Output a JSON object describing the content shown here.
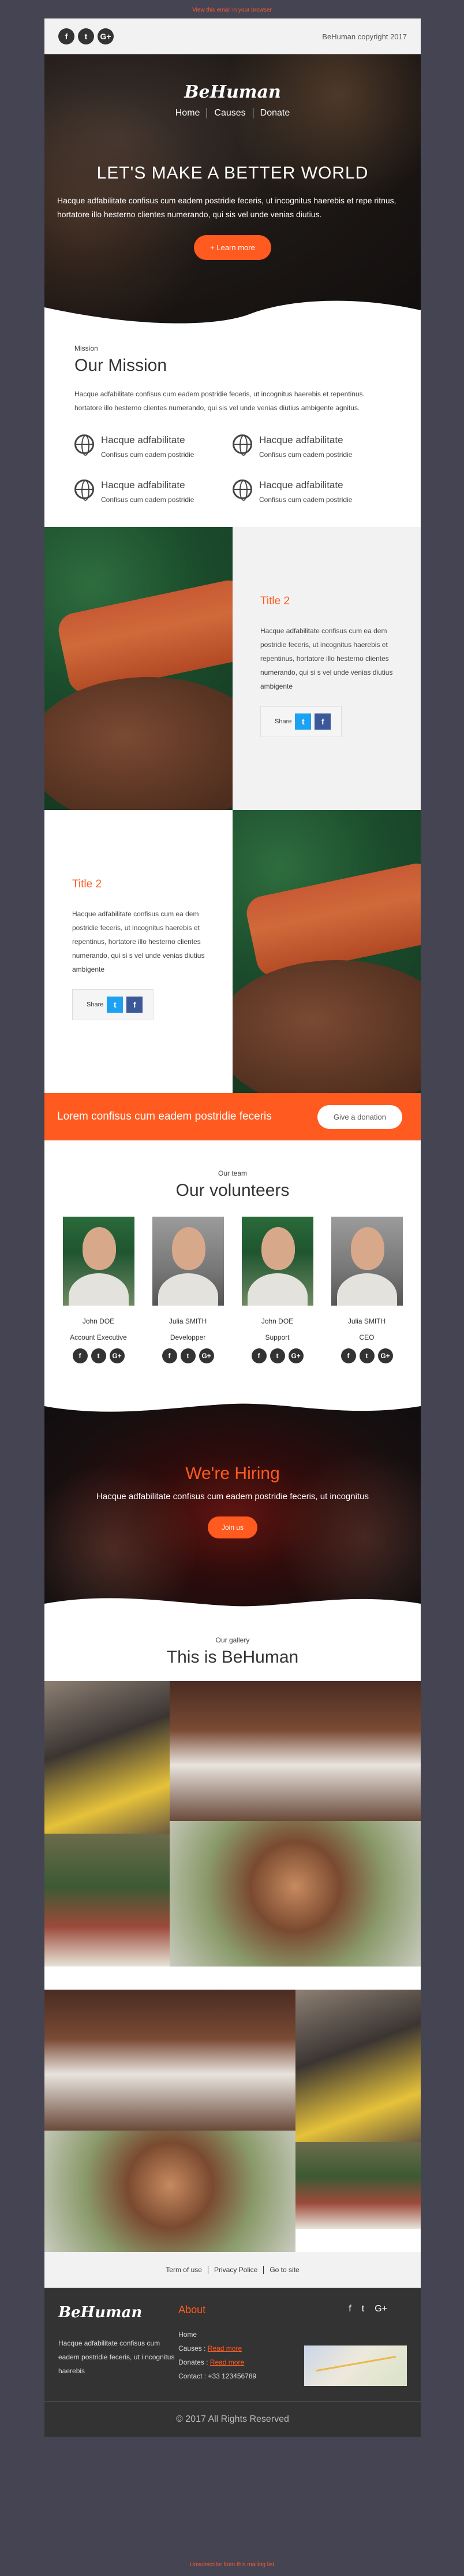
{
  "preheader": {
    "link": "View this email in your browser"
  },
  "topbar": {
    "social": [
      {
        "icon": "facebook-icon",
        "glyph": "f"
      },
      {
        "icon": "twitter-icon",
        "glyph": "t"
      },
      {
        "icon": "google-plus-icon",
        "glyph": "G+"
      }
    ],
    "copyright": "BeHuman copyright 2017"
  },
  "hero": {
    "logo": "BeHuman",
    "nav": [
      "Home",
      "Causes",
      "Donate"
    ],
    "title": "LET'S MAKE A BETTER WORLD",
    "text": "Hacque adfabilitate confisus cum eadem postridie feceris, ut incognitus haerebis et repe ritnus, hortatore illo hesterno clientes numerando, qui sis vel unde venias diutius.",
    "button": "+ Learn more"
  },
  "mission": {
    "eyebrow": "Mission",
    "title": "Our Mission",
    "text": "Hacque adfabilitate confisus cum eadem postridie feceris, ut incognitus haerebis et repentinus. hortatore illo hesterno clientes numerando, qui sis vel unde venias diutius ambigente agnitus.",
    "features": [
      {
        "title": "Hacque adfabilitate",
        "sub": "Confisus cum eadem postridie"
      },
      {
        "title": "Hacque adfabilitate",
        "sub": "Confisus cum eadem postridie"
      },
      {
        "title": "Hacque adfabilitate",
        "sub": "Confisus cum eadem postridie"
      },
      {
        "title": "Hacque adfabilitate",
        "sub": "Confisus cum eadem postridie"
      }
    ]
  },
  "blocks": [
    {
      "title": "Title 2",
      "text": "Hacque adfabilitate confisus cum ea dem postridie feceris, ut incognitus haerebis et repentinus, hortatore illo hesterno clientes numerando, qui si s vel unde venias diutius ambigente",
      "share": "Share"
    },
    {
      "title": "Title 2",
      "text": "Hacque adfabilitate confisus cum ea dem postridie feceris, ut incognitus haerebis et repentinus, hortatore illo hesterno clientes numerando, qui si s vel unde venias diutius ambigente",
      "share": "Share"
    }
  ],
  "donation": {
    "text": "Lorem confisus cum eadem postridie feceris",
    "button": "Give a donation"
  },
  "team": {
    "eyebrow": "Our team",
    "title": "Our volunteers",
    "members": [
      {
        "name": "John DOE",
        "role": "Account Executive"
      },
      {
        "name": "Julia SMITH",
        "role": "Developper"
      },
      {
        "name": "John DOE",
        "role": "Support"
      },
      {
        "name": "Julia SMITH",
        "role": "CEO"
      }
    ]
  },
  "hiring": {
    "title": "We're Hiring",
    "text": "Hacque adfabilitate confisus cum eadem postridie feceris, ut incognitus",
    "button": "Join us"
  },
  "gallery": {
    "eyebrow": "Our gallery",
    "title": "This is BeHuman"
  },
  "footer": {
    "links": [
      "Term of use",
      "Privacy Police",
      "Go to site"
    ],
    "logo": "BeHuman",
    "desc": "Hacque adfabilitate confisus cum eadem postridie feceris, ut i ncognitus haerebis",
    "about_title": "About",
    "about": [
      {
        "label": "Home",
        "link": ""
      },
      {
        "label": "Causes : ",
        "link": "Read more"
      },
      {
        "label": "Donates : ",
        "link": "Read more"
      },
      {
        "label": "Contact : +33 123456789",
        "link": ""
      }
    ],
    "social": [
      {
        "icon": "facebook-icon",
        "glyph": "f"
      },
      {
        "icon": "twitter-icon",
        "glyph": "t"
      },
      {
        "icon": "google-plus-icon",
        "glyph": "G+"
      }
    ],
    "copyright": "© 2017 All Rights Reserved"
  },
  "postfooter": {
    "link": "Unsubscribe from this mailing list"
  },
  "colors": {
    "accent": "#ff5a1f",
    "page_bg": "#454452",
    "footer_bg": "#333333"
  }
}
